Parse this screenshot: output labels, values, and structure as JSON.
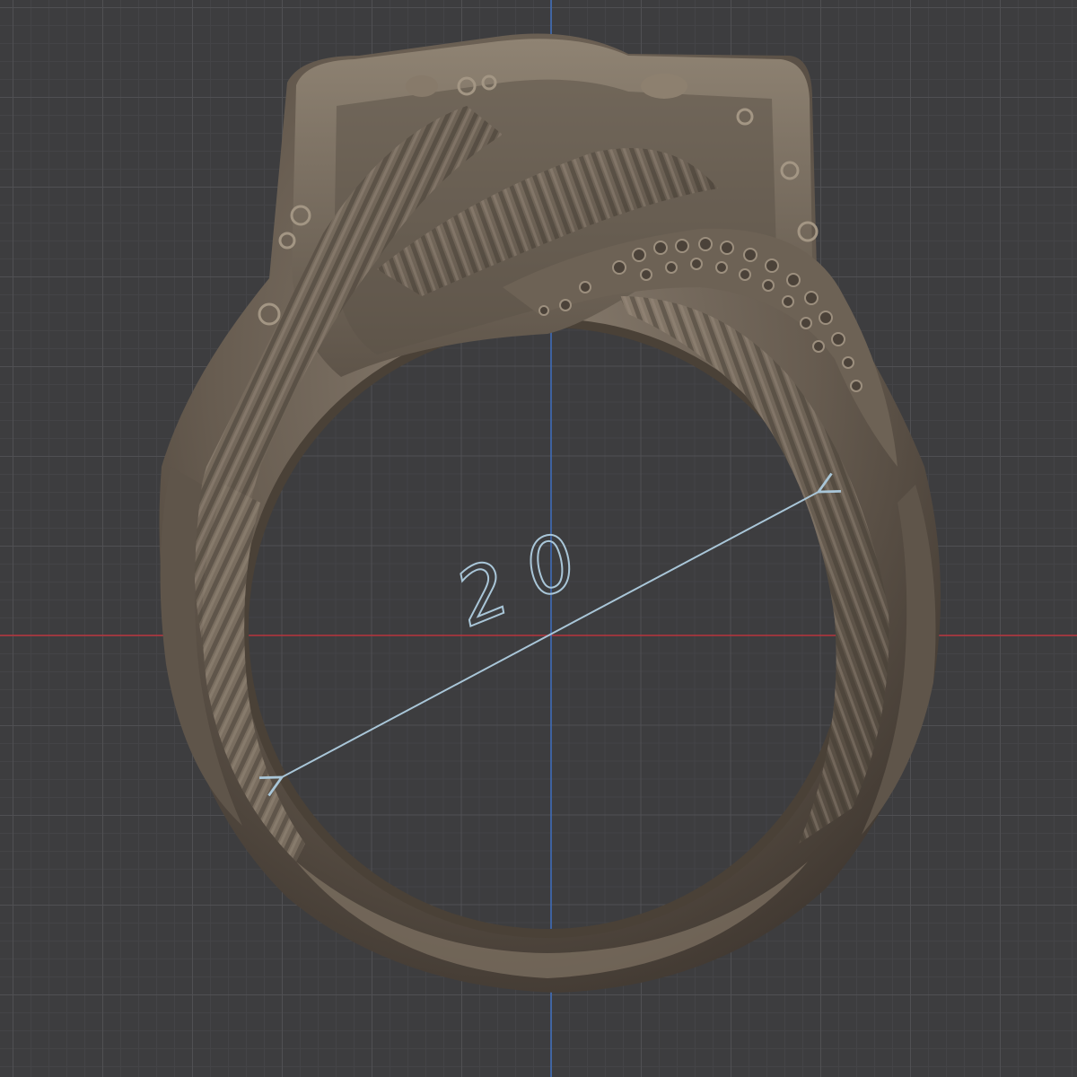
{
  "viewport": {
    "background_color": "#3d3d3f",
    "grid_minor_color": "#444447",
    "grid_major_color": "#505053",
    "x_axis_color": "#b8343d",
    "y_axis_color": "#3e6fc0"
  },
  "model": {
    "name": "ring",
    "material_color": "#6b6054"
  },
  "measurement": {
    "label": "20",
    "color": "#a9c6d8"
  }
}
